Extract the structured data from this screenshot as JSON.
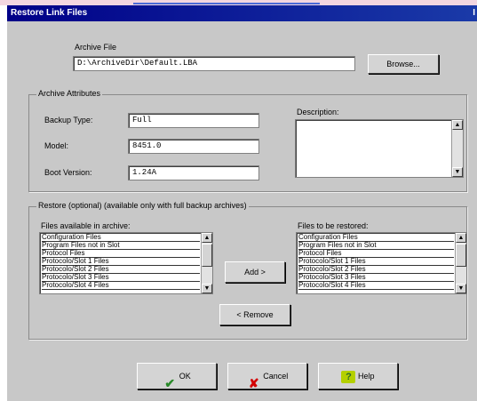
{
  "window": {
    "title": "Restore Link Files",
    "title_right": "I"
  },
  "archive": {
    "label": "Archive File",
    "path": "D:\\ArchiveDir\\Default.LBA",
    "browse_label": "Browse..."
  },
  "attributes": {
    "legend": "Archive Attributes",
    "backup_type_label": "Backup Type:",
    "backup_type_value": "Full",
    "model_label": "Model:",
    "model_value": "8451.0",
    "boot_version_label": "Boot Version:",
    "boot_version_value": "1.24A",
    "description_label": "Description:",
    "description_value": ""
  },
  "restore": {
    "legend": "Restore (optional) (available only with full backup archives)",
    "available_label": "Files available in archive:",
    "restore_label": "Files to be restored:",
    "available_items": [
      "Configuration Files",
      "Program Files not in Slot",
      "Protocol Files",
      "Protocolo/Slot 1 Files",
      "Protocolo/Slot 2 Files",
      "Protocolo/Slot 3 Files",
      "Protocolo/Slot 4 Files"
    ],
    "restore_items": [
      "Configuration Files",
      "Program Files not in Slot",
      "Protocol Files",
      "Protocolo/Slot 1 Files",
      "Protocolo/Slot 2 Files",
      "Protocolo/Slot 3 Files",
      "Protocolo/Slot 4 Files"
    ],
    "add_label": "Add >",
    "remove_label": "< Remove"
  },
  "buttons": {
    "ok_label": "OK",
    "cancel_label": "Cancel",
    "help_label": "Help"
  },
  "colors": {
    "titlebar": "#000088",
    "dialog_bg": "#c8c8c8",
    "top_strip": "#f3d6e0"
  }
}
